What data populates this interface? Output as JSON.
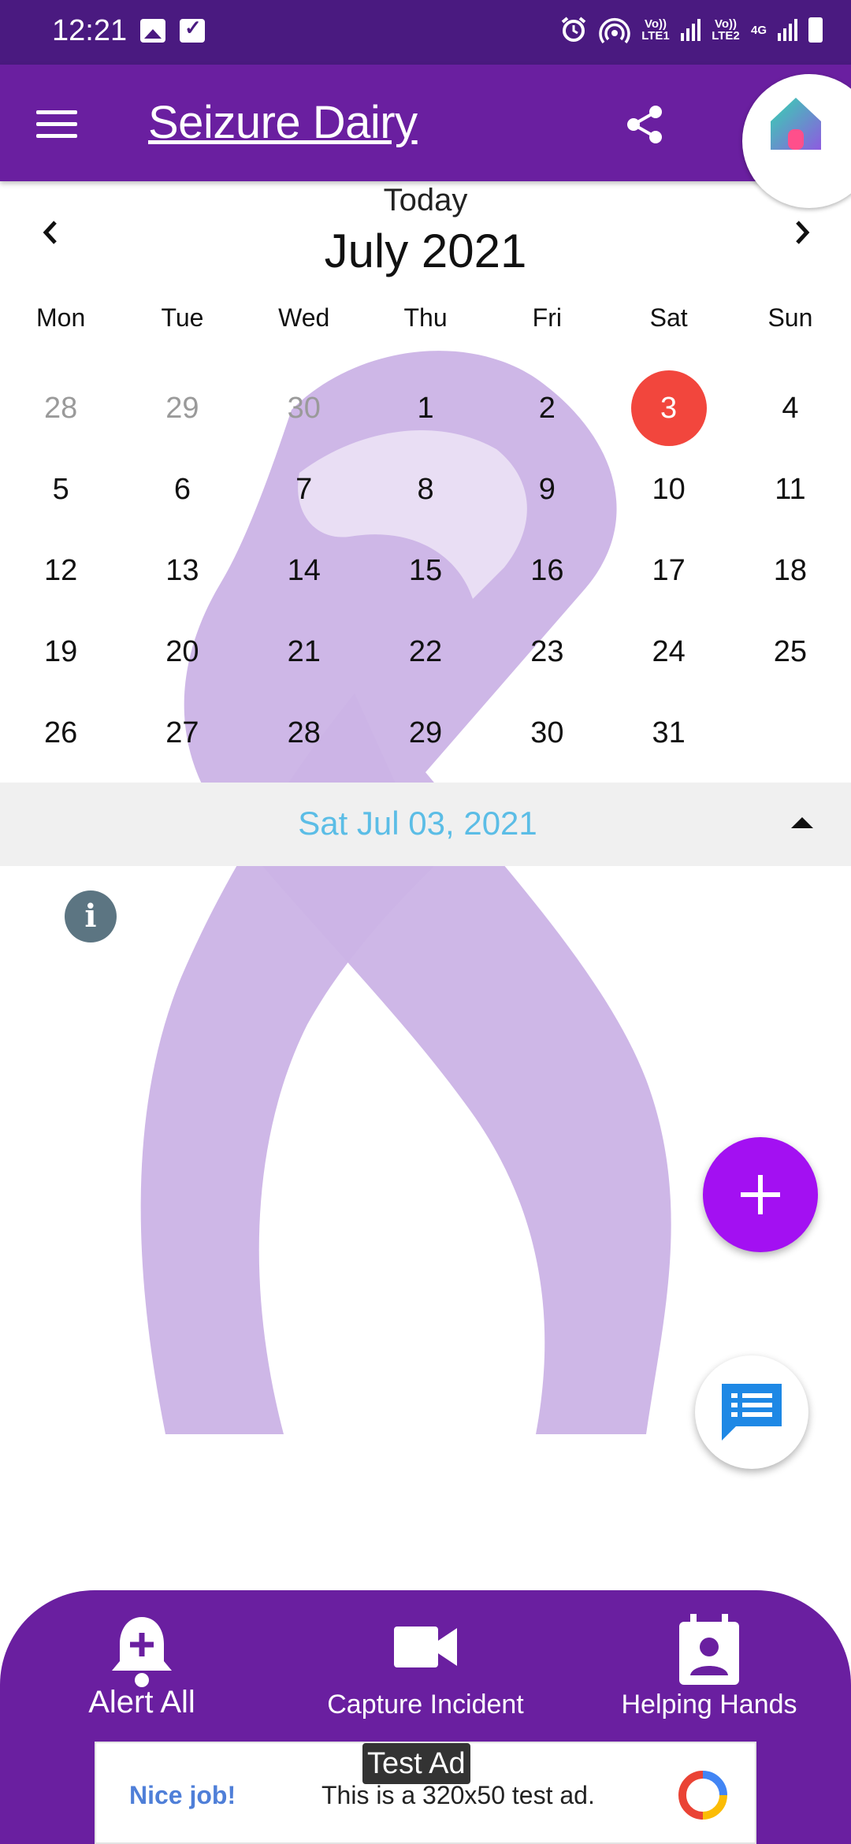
{
  "status_bar": {
    "time": "12:21",
    "lte1": "Vo)) LTE1",
    "lte2": "Vo)) LTE2",
    "network": "4G"
  },
  "app_bar": {
    "title": "Seizure Dairy"
  },
  "calendar": {
    "today_label": "Today",
    "month_label": "July 2021",
    "weekdays": [
      "Mon",
      "Tue",
      "Wed",
      "Thu",
      "Fri",
      "Sat",
      "Sun"
    ],
    "days": [
      {
        "label": "28",
        "muted": true
      },
      {
        "label": "29",
        "muted": true
      },
      {
        "label": "30",
        "muted": true
      },
      {
        "label": "1"
      },
      {
        "label": "2"
      },
      {
        "label": "3",
        "selected": true
      },
      {
        "label": "4"
      },
      {
        "label": "5"
      },
      {
        "label": "6"
      },
      {
        "label": "7"
      },
      {
        "label": "8"
      },
      {
        "label": "9"
      },
      {
        "label": "10"
      },
      {
        "label": "11"
      },
      {
        "label": "12"
      },
      {
        "label": "13"
      },
      {
        "label": "14"
      },
      {
        "label": "15"
      },
      {
        "label": "16"
      },
      {
        "label": "17"
      },
      {
        "label": "18"
      },
      {
        "label": "19"
      },
      {
        "label": "20"
      },
      {
        "label": "21"
      },
      {
        "label": "22"
      },
      {
        "label": "23"
      },
      {
        "label": "24"
      },
      {
        "label": "25"
      },
      {
        "label": "26"
      },
      {
        "label": "27"
      },
      {
        "label": "28"
      },
      {
        "label": "29"
      },
      {
        "label": "30"
      },
      {
        "label": "31"
      },
      {
        "label": ""
      }
    ],
    "selected_date": "Sat Jul 03, 2021"
  },
  "info_icon_glyph": "i",
  "bottom_nav": {
    "alert_all": "Alert All",
    "capture_incident": "Capture Incident",
    "helping_hands": "Helping Hands"
  },
  "ad": {
    "tag": "Test Ad",
    "nice": "Nice job!",
    "text": "This is a 320x50 test ad."
  },
  "colors": {
    "status_bar": "#4a1a80",
    "app_bar": "#6a1fa0",
    "selected_day": "#f2463d",
    "fab_add": "#a310f2",
    "date_label": "#5bbde6",
    "ribbon": "#cbb3e6"
  },
  "icons": [
    "menu-icon",
    "share-icon",
    "home-icon",
    "chevron-left-icon",
    "chevron-right-icon",
    "caret-up-icon",
    "info-icon",
    "plus-icon",
    "chat-icon",
    "bell-plus-icon",
    "video-camera-icon",
    "contact-badge-icon"
  ]
}
